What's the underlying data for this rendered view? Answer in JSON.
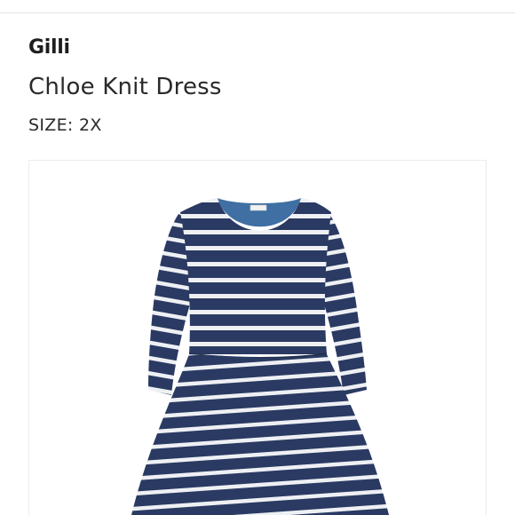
{
  "product": {
    "brand": "Gilli",
    "name": "Chloe Knit Dress",
    "size_label": "SIZE:",
    "size_value": "2X"
  },
  "image": {
    "subject": "dress-icon",
    "colors": {
      "navy": "#2a3a62",
      "stripe": "#eef0f4",
      "lining": "#3f6fa3"
    }
  }
}
